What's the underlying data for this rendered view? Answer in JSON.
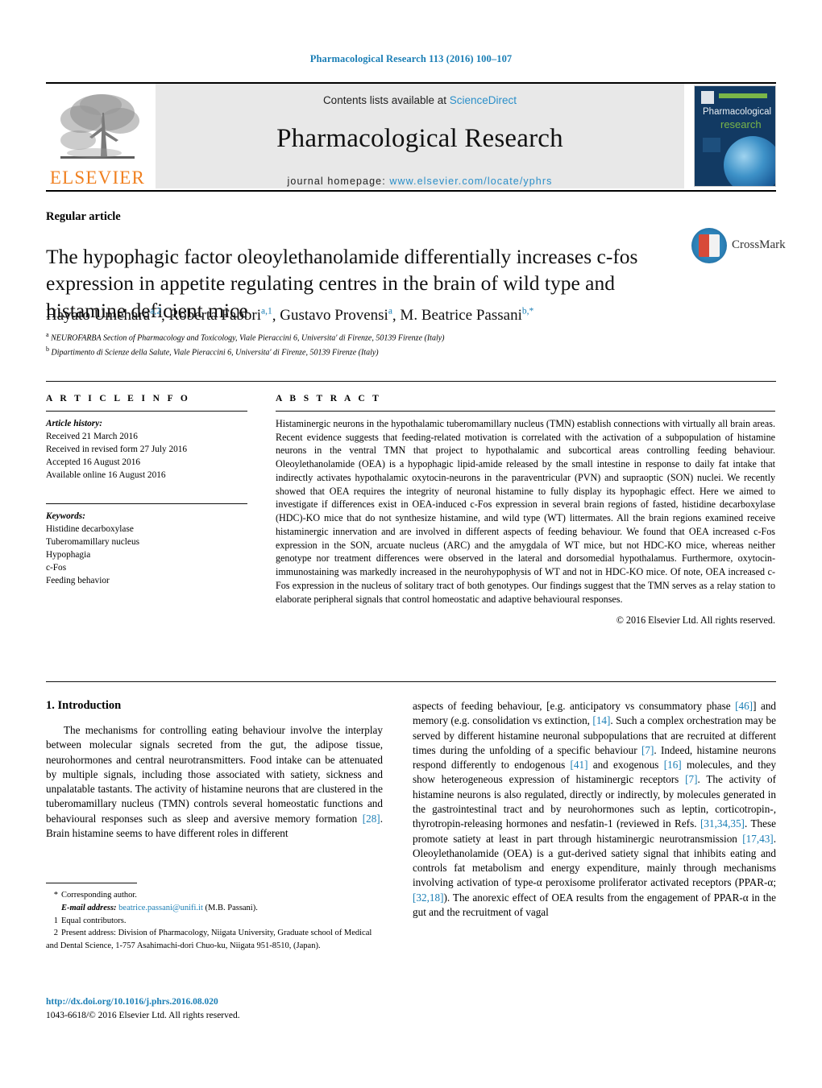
{
  "running_head": "Pharmacological Research 113 (2016) 100–107",
  "header": {
    "publisher_name": "ELSEVIER",
    "contents_prefix": "Contents lists available at ",
    "contents_link": "ScienceDirect",
    "journal_title": "Pharmacological Research",
    "homepage_prefix": "journal homepage: ",
    "homepage_url": "www.elsevier.com/locate/yphrs",
    "cover": {
      "line1": "Pharmacological",
      "line2": "research"
    }
  },
  "article_type": "Regular article",
  "title": "The hypophagic factor oleoylethanolamide differentially increases c-fos expression in appetite regulating centres in the brain of wild type and histamine deficient mice",
  "crossmark_label": "CrossMark",
  "authors": [
    {
      "name": "Hayato Umehara",
      "marks": "a,2"
    },
    {
      "name": "Roberta Fabbri",
      "marks": "a,1"
    },
    {
      "name": "Gustavo Provensi",
      "marks": "a"
    },
    {
      "name": "M. Beatrice Passani",
      "marks": "b,*"
    }
  ],
  "affiliations": [
    {
      "mark": "a",
      "text": "NEUROFARBA Section of Pharmacology and Toxicology, Viale Pieraccini 6, Universita' di Firenze, 50139 Firenze (Italy)"
    },
    {
      "mark": "b",
      "text": "Dipartimento di Scienze della Salute, Viale Pieraccini 6, Universita' di Firenze, 50139 Firenze (Italy)"
    }
  ],
  "article_info": {
    "heading": "A R T I C L E   I N F O",
    "history_label": "Article history:",
    "history": [
      "Received 21 March 2016",
      "Received in revised form 27 July 2016",
      "Accepted 16 August 2016",
      "Available online 16 August 2016"
    ],
    "keywords_label": "Keywords:",
    "keywords": [
      "Histidine decarboxylase",
      "Tuberomamillary nucleus",
      "Hypophagia",
      "c-Fos",
      "Feeding behavior"
    ]
  },
  "abstract": {
    "heading": "A B S T R A C T",
    "text": "Histaminergic neurons in the hypothalamic tuberomamillary nucleus (TMN) establish connections with virtually all brain areas. Recent evidence suggests that feeding-related motivation is correlated with the activation of a subpopulation of histamine neurons in the ventral TMN that project to hypothalamic and subcortical areas controlling feeding behaviour. Oleoylethanolamide (OEA) is a hypophagic lipid-amide released by the small intestine in response to daily fat intake that indirectly activates hypothalamic oxytocin-neurons in the paraventricular (PVN) and supraoptic (SON) nuclei. We recently showed that OEA requires the integrity of neuronal histamine to fully display its hypophagic effect. Here we aimed to investigate if differences exist in OEA-induced c-Fos expression in several brain regions of fasted, histidine decarboxylase (HDC)-KO mice that do not synthesize histamine, and wild type (WT) littermates. All the brain regions examined receive histaminergic innervation and are involved in different aspects of feeding behaviour. We found that OEA increased c-Fos expression in the SON, arcuate nucleus (ARC) and the amygdala of WT mice, but not HDC-KO mice, whereas neither genotype nor treatment differences were observed in the lateral and dorsomedial hypothalamus. Furthermore, oxytocin-immunostaining was markedly increased in the neurohypophysis of WT and not in HDC-KO mice. Of note, OEA increased c-Fos expression in the nucleus of solitary tract of both genotypes. Our findings suggest that the TMN serves as a relay station to elaborate peripheral signals that control homeostatic and adaptive behavioural responses.",
    "copyright": "© 2016 Elsevier Ltd. All rights reserved."
  },
  "body": {
    "section_title": "1. Introduction",
    "left_paragraph_html": "The mechanisms for controlling eating behaviour involve the interplay between molecular signals secreted from the gut, the adipose tissue, neurohormones and central neurotransmitters. Food intake can be attenuated by multiple signals, including those associated with satiety, sickness and unpalatable tastants. The activity of histamine neurons that are clustered in the tuberomamillary nucleus (TMN) controls several homeostatic functions and behavioural responses such as sleep and aversive memory formation [28]. Brain histamine seems to have different roles in different",
    "right_paragraph_html": "aspects of feeding behaviour, [e.g. anticipatory vs consummatory phase [46]] and memory (e.g. consolidation vs extinction, [14]. Such a complex orchestration may be served by different histamine neuronal subpopulations that are recruited at different times during the unfolding of a specific behaviour [7]. Indeed, histamine neurons respond differently to endogenous [41] and exogenous [16] molecules, and they show heterogeneous expression of histaminergic receptors [7]. The activity of histamine neurons is also regulated, directly or indirectly, by molecules generated in the gastrointestinal tract and by neurohormones such as leptin, corticotropin-, thyrotropin-releasing hormones and nesfatin-1 (reviewed in Refs. [31,34,35]. These promote satiety at least in part through histaminergic neurotransmission [17,43]. Oleoylethanolamide (OEA) is a gut-derived satiety signal that inhibits eating and controls fat metabolism and energy expenditure, mainly through mechanisms involving activation of type-α peroxisome proliferator activated receptors (PPAR-α; [32,18]). The anorexic effect of OEA results from the engagement of PPAR-α in the gut and the recruitment of vagal"
  },
  "footnotes": {
    "corresponding": "Corresponding author.",
    "email_label": "E-mail address:",
    "email": "beatrice.passani@unifi.it",
    "email_suffix": "(M.B. Passani).",
    "note1_mark": "1",
    "note1": "Equal contributors.",
    "note2_mark": "2",
    "note2": "Present address: Division of Pharmacology, Niigata University, Graduate school of Medical and Dental Science, 1-757 Asahimachi-dori Chuo-ku, Niigata 951-8510, (Japan)."
  },
  "doi": {
    "url": "http://dx.doi.org/10.1016/j.phrs.2016.08.020",
    "issn_line": "1043-6618/© 2016 Elsevier Ltd. All rights reserved."
  },
  "colors": {
    "link_blue": "#1a7eb5",
    "elsevier_orange": "#f08020",
    "band_gray": "#e8e8e8"
  }
}
